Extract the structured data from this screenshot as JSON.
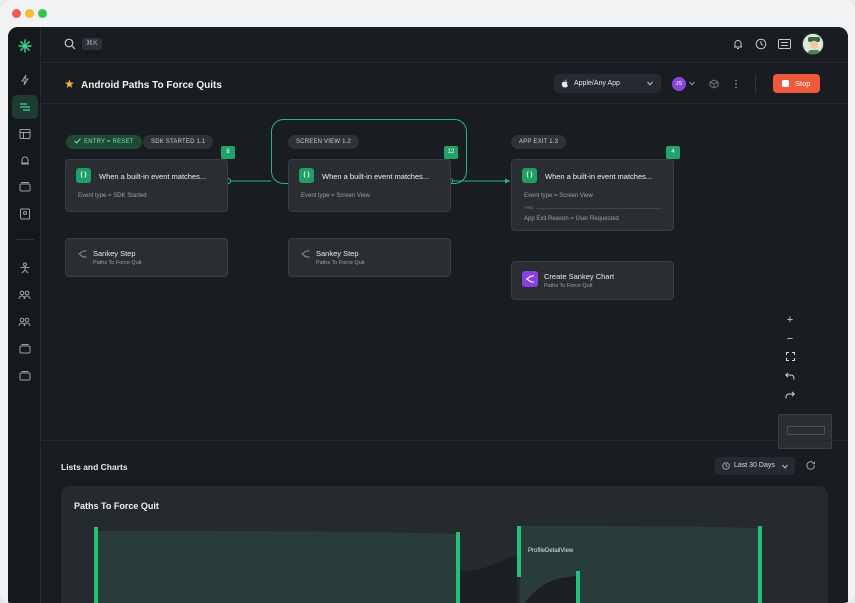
{
  "topbar": {
    "shortcut": "⌘K"
  },
  "header": {
    "title": "Android Paths To Force Quits",
    "app_selector": "Apple/Any App",
    "user_initials": "JS",
    "stop_label": "Stop"
  },
  "flow": {
    "entry_label": "ENTRY = RESET",
    "steps": [
      {
        "tag": "SDK STARTED 1.1",
        "count": "8",
        "event": "When a built-in event matches...",
        "detail": "Event type = SDK Started",
        "action": "Sankey Step",
        "action_sub": "Paths To Force Quit"
      },
      {
        "tag": "SCREEN VIEW 1.2",
        "count": "12",
        "event": "When a built-in event matches...",
        "detail": "Event type = Screen View",
        "action": "Sankey Step",
        "action_sub": "Paths To Force Quit"
      },
      {
        "tag": "APP EXIT 1.3",
        "count": "4",
        "event": "When a built-in event matches...",
        "detail": "Event type = Screen View",
        "and_label": "AND",
        "detail2": "App Exit Reason = User Requested",
        "action": "Create Sankey Chart",
        "action_sub": "Paths To Force Quit"
      }
    ]
  },
  "lists": {
    "title": "Lists and Charts",
    "date_range": "Last 30 Days"
  },
  "chart": {
    "title": "Paths To Force Quit",
    "node_label": "ProfileDetailView"
  },
  "colors": {
    "accent": "#22a36b",
    "stop": "#f05a3c",
    "star": "#f4b934"
  }
}
